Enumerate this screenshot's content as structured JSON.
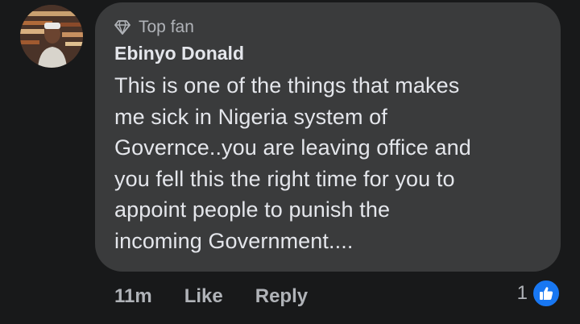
{
  "comment": {
    "badge_label": "Top fan",
    "badge_icon": "diamond-icon",
    "author_name": "Ebinyo Donald",
    "text": "This is one of the things that makes\nme sick in Nigeria system of\nGovernce..you are leaving  office and\nyou fell this the right time for you  to\nappoint people to punish the\nincoming Government...."
  },
  "actions": {
    "time": "11m",
    "like_label": "Like",
    "reply_label": "Reply"
  },
  "reactions": {
    "count": "1",
    "icon": "thumbs-up-icon",
    "color": "#1877f2"
  },
  "colors": {
    "background": "#18191a",
    "bubble": "#3a3b3c",
    "primary_text": "#e4e6eb",
    "secondary_text": "#b0b3b8"
  }
}
